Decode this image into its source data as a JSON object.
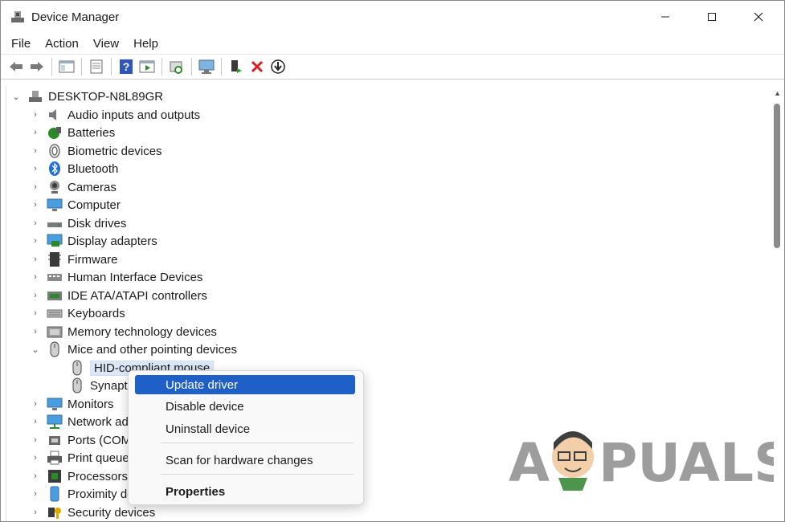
{
  "window": {
    "title": "Device Manager"
  },
  "menu": [
    "File",
    "Action",
    "View",
    "Help"
  ],
  "toolbar": {
    "buttons": [
      "back-icon",
      "forward-icon",
      "properties-pane-icon",
      "device-list-icon",
      "help-icon",
      "run-icon",
      "scan-icon",
      "monitor-icon",
      "add-driver-icon",
      "uninstall-icon",
      "download-icon"
    ]
  },
  "tree": {
    "root": "DESKTOP-N8L89GR",
    "categories": [
      "Audio inputs and outputs",
      "Batteries",
      "Biometric devices",
      "Bluetooth",
      "Cameras",
      "Computer",
      "Disk drives",
      "Display adapters",
      "Firmware",
      "Human Interface Devices",
      "IDE ATA/ATAPI controllers",
      "Keyboards",
      "Memory technology devices",
      "Mice and other pointing devices"
    ],
    "mice_children": [
      "HID-compliant mouse",
      "Synaptics"
    ],
    "after": [
      "Monitors",
      "Network ad",
      "Ports (COM",
      "Print queue",
      "Processors",
      "Proximity de",
      "Security devices"
    ]
  },
  "context_menu": {
    "update": "Update driver",
    "disable": "Disable device",
    "uninstall": "Uninstall device",
    "scan": "Scan for hardware changes",
    "properties": "Properties"
  },
  "watermark": {
    "text": "A PUALS"
  }
}
